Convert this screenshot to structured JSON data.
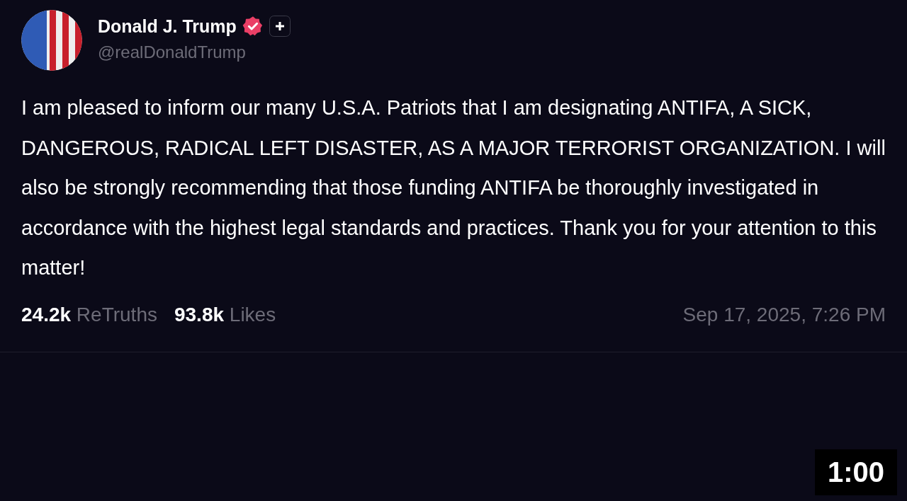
{
  "post": {
    "author": {
      "name": "Donald J. Trump",
      "verified": true,
      "handle": "@realDonaldTrump"
    },
    "text": "I am pleased to inform our many U.S.A. Patriots that I am designating ANTIFA, A SICK, DANGEROUS, RADICAL LEFT DISASTER, AS A MAJOR TERRORIST ORGANIZATION. I will also be strongly recommending that those funding ANTIFA be thoroughly investigated in accordance with the highest legal standards and practices. Thank you for your attention to this matter!",
    "stats": [
      {
        "count": "24.2k",
        "label": "ReTruths"
      },
      {
        "count": "93.8k",
        "label": "Likes"
      }
    ],
    "timestamp": "Sep 17, 2025, 7:26 PM"
  },
  "video": {
    "duration": "1:00"
  }
}
